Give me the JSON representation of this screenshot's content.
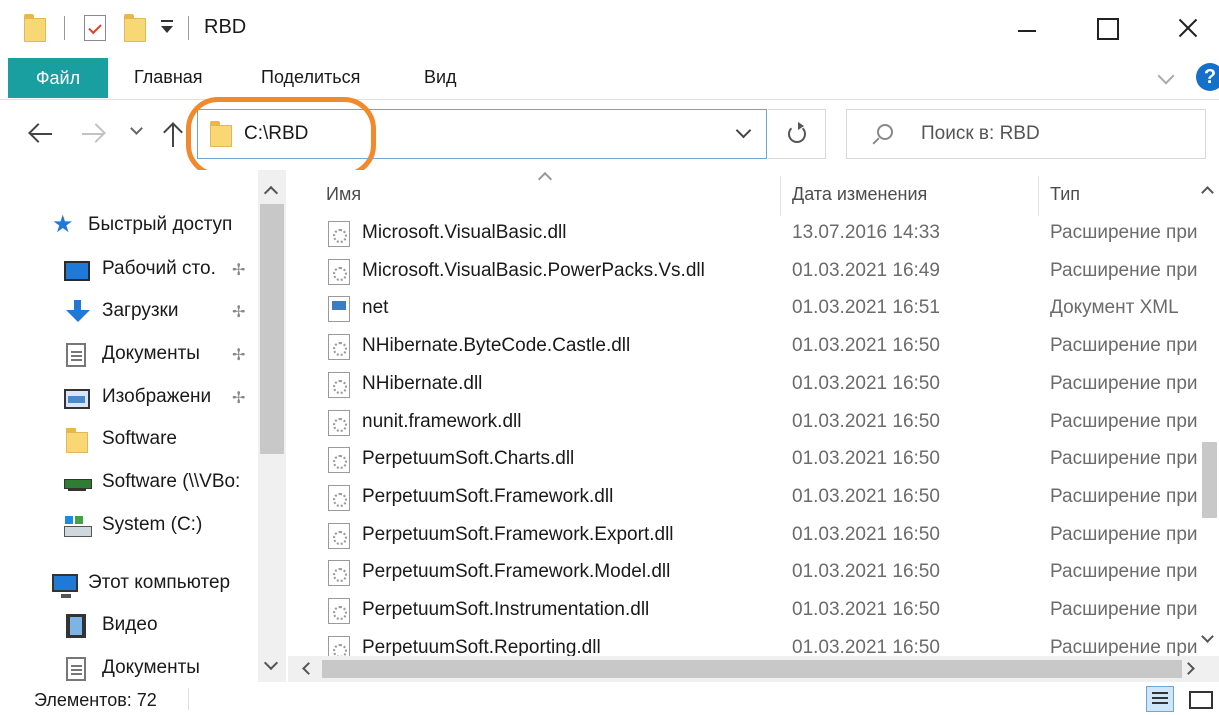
{
  "window": {
    "title": "RBD"
  },
  "ribbon": {
    "tabs": [
      "Файл",
      "Главная",
      "Поделиться",
      "Вид"
    ],
    "help_label": "?"
  },
  "address": {
    "path": "C:\\RBD"
  },
  "search": {
    "placeholder": "Поиск в: RBD"
  },
  "nav_pane": {
    "items": [
      {
        "label": "Быстрый доступ",
        "icon": "star-icon",
        "pinned": false
      },
      {
        "label": "Рабочий сто.",
        "icon": "desktop-icon",
        "pinned": true
      },
      {
        "label": "Загрузки",
        "icon": "downloads-icon",
        "pinned": true
      },
      {
        "label": "Документы",
        "icon": "documents-icon",
        "pinned": true
      },
      {
        "label": "Изображени",
        "icon": "pictures-icon",
        "pinned": true
      },
      {
        "label": "Software",
        "icon": "folder-icon",
        "pinned": false
      },
      {
        "label": "Software (\\\\VBo:",
        "icon": "network-drive-icon",
        "pinned": false
      },
      {
        "label": "System (C:)",
        "icon": "drive-icon",
        "pinned": false
      },
      {
        "label": "Этот компьютер",
        "icon": "computer-icon",
        "pinned": false
      },
      {
        "label": "Видео",
        "icon": "video-icon",
        "pinned": false
      },
      {
        "label": "Документы",
        "icon": "documents-icon",
        "pinned": false
      }
    ]
  },
  "file_list": {
    "columns": {
      "name": "Имя",
      "date": "Дата изменения",
      "type": "Тип"
    },
    "rows": [
      {
        "name": "Microsoft.VisualBasic.dll",
        "date": "13.07.2016 14:33",
        "type": "Расширение при",
        "icon": "dll-file-icon"
      },
      {
        "name": "Microsoft.VisualBasic.PowerPacks.Vs.dll",
        "date": "01.03.2021 16:49",
        "type": "Расширение при",
        "icon": "dll-file-icon"
      },
      {
        "name": "net",
        "date": "01.03.2021 16:51",
        "type": "Документ XML",
        "icon": "xml-file-icon"
      },
      {
        "name": "NHibernate.ByteCode.Castle.dll",
        "date": "01.03.2021 16:50",
        "type": "Расширение при",
        "icon": "dll-file-icon"
      },
      {
        "name": "NHibernate.dll",
        "date": "01.03.2021 16:50",
        "type": "Расширение при",
        "icon": "dll-file-icon"
      },
      {
        "name": "nunit.framework.dll",
        "date": "01.03.2021 16:50",
        "type": "Расширение при",
        "icon": "dll-file-icon"
      },
      {
        "name": "PerpetuumSoft.Charts.dll",
        "date": "01.03.2021 16:50",
        "type": "Расширение при",
        "icon": "dll-file-icon"
      },
      {
        "name": "PerpetuumSoft.Framework.dll",
        "date": "01.03.2021 16:50",
        "type": "Расширение при",
        "icon": "dll-file-icon"
      },
      {
        "name": "PerpetuumSoft.Framework.Export.dll",
        "date": "01.03.2021 16:50",
        "type": "Расширение при",
        "icon": "dll-file-icon"
      },
      {
        "name": "PerpetuumSoft.Framework.Model.dll",
        "date": "01.03.2021 16:50",
        "type": "Расширение при",
        "icon": "dll-file-icon"
      },
      {
        "name": "PerpetuumSoft.Instrumentation.dll",
        "date": "01.03.2021 16:50",
        "type": "Расширение при",
        "icon": "dll-file-icon"
      },
      {
        "name": "PerpetuumSoft.Reporting.dll",
        "date": "01.03.2021 16:50",
        "type": "Расширение при",
        "icon": "dll-file-icon"
      }
    ]
  },
  "status": {
    "items_count": "Элементов: 72"
  },
  "colors": {
    "file_tab": "#1a9fa0",
    "highlight": "#f08a2c",
    "accent": "#1e7ad6"
  }
}
